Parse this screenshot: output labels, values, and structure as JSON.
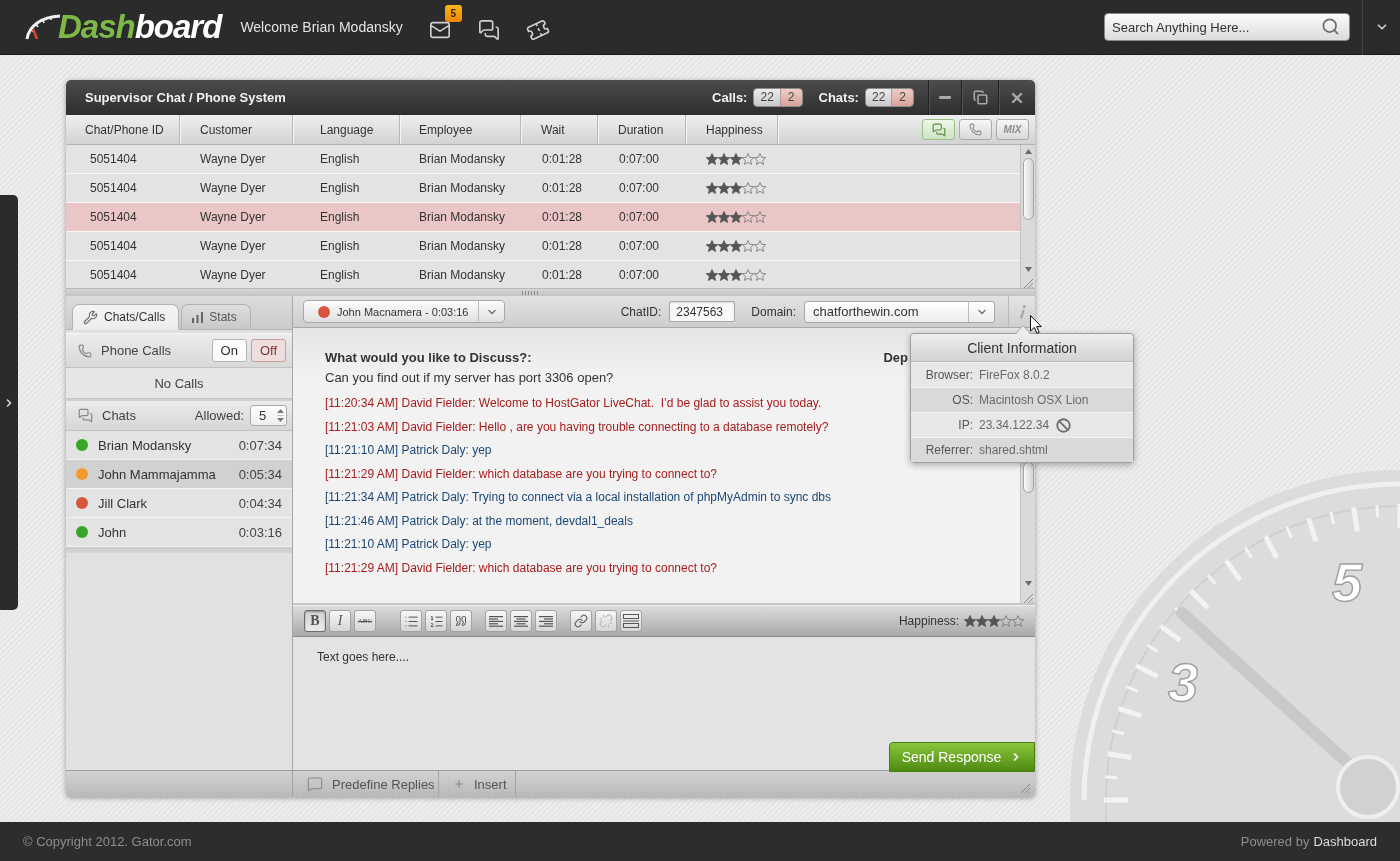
{
  "topbar": {
    "logo": {
      "accent": "Dash",
      "rest": "board"
    },
    "welcome": "Welcome Brian Modansky",
    "icons": [
      {
        "kind": "mail",
        "badge": "5"
      },
      {
        "kind": "chat"
      },
      {
        "kind": "ticket"
      }
    ],
    "search": {
      "placeholder": "Search Anything Here..."
    }
  },
  "window": {
    "title": "Supervisor Chat / Phone System",
    "counters": [
      {
        "label": "Calls:",
        "total": "22",
        "pending": "2"
      },
      {
        "label": "Chats:",
        "total": "22",
        "pending": "2"
      }
    ]
  },
  "table": {
    "columns": [
      "Chat/Phone ID",
      "Customer",
      "Language",
      "Employee",
      "Wait",
      "Duration",
      "Happiness"
    ],
    "view_toggles": [
      {
        "kind": "chat",
        "selected": true
      },
      {
        "kind": "phone",
        "selected": false
      },
      {
        "kind": "mix",
        "label": "MIX",
        "selected": false
      }
    ],
    "rows": [
      {
        "cells": [
          "5051404",
          "Wayne Dyer",
          "English",
          "Brian Modansky",
          "0:01:28",
          "0:07:00"
        ],
        "stars": 3,
        "selected": false
      },
      {
        "cells": [
          "5051404",
          "Wayne Dyer",
          "English",
          "Brian Modansky",
          "0:01:28",
          "0:07:00"
        ],
        "stars": 3,
        "selected": false
      },
      {
        "cells": [
          "5051404",
          "Wayne Dyer",
          "English",
          "Brian Modansky",
          "0:01:28",
          "0:07:00"
        ],
        "stars": 3,
        "selected": true
      },
      {
        "cells": [
          "5051404",
          "Wayne Dyer",
          "English",
          "Brian Modansky",
          "0:01:28",
          "0:07:00"
        ],
        "stars": 3,
        "selected": false
      },
      {
        "cells": [
          "5051404",
          "Wayne Dyer",
          "English",
          "Brian Modansky",
          "0:01:28",
          "0:07:00"
        ],
        "stars": 3,
        "selected": false
      }
    ]
  },
  "sidebar": {
    "tabs": [
      {
        "kind": "tools",
        "label": "Chats/Calls",
        "selected": true
      },
      {
        "kind": "stats",
        "label": "Stats",
        "selected": false
      }
    ],
    "phone_calls": {
      "label": "Phone Calls",
      "on_label": "On",
      "off_label": "Off",
      "on": false
    },
    "no_calls": "No Calls",
    "chats": {
      "label": "Chats",
      "allowed_label": "Allowed:",
      "allowed": "5"
    },
    "chat_list": [
      {
        "name": "Brian Modansky",
        "time": "0:07:34",
        "color": "#3aa52a",
        "selected": false
      },
      {
        "name": "John Mammajamma",
        "time": "0:05:34",
        "color": "#f39a2b",
        "selected": true
      },
      {
        "name": "Jill Clark",
        "time": "0:04:34",
        "color": "#d9543c",
        "selected": false
      },
      {
        "name": "John",
        "time": "0:03:16",
        "color": "#3aa52a",
        "selected": false
      }
    ]
  },
  "conversation": {
    "session": {
      "label": "John Macnamera - 0:03:16",
      "color": "#d9543c"
    },
    "chat_id_label": "ChatID:",
    "chat_id": "2347563",
    "domain_label": "Domain:",
    "domain": "chatforthewin.com",
    "question_label": "What would you like to Discuss?:",
    "question": "Can you find out if my server has port 3306 open?",
    "side_label": "Dep",
    "messages": [
      {
        "kind": "agent",
        "text": "[11:20:34 AM] David Fielder: Welcome to HostGator LiveChat.  I’d be glad to assist you today."
      },
      {
        "kind": "agent",
        "text": "[11:21:03 AM] David Fielder: Hello , are you having trouble connecting to a database remotely?"
      },
      {
        "kind": "customer",
        "text": "[11:21:10 AM] Patrick Daly: yep"
      },
      {
        "kind": "agent",
        "text": "[11:21:29 AM] David Fielder: which database are you trying to connect to?"
      },
      {
        "kind": "customer",
        "text": "[11:21:34 AM] Patrick Daly: Trying to connect via a local installation of phpMyAdmin to sync dbs"
      },
      {
        "kind": "customer",
        "text": "[11:21:46 AM] Patrick Daly: at the moment, devdal1_deals"
      },
      {
        "kind": "customer",
        "text": "[11:21:10 AM] Patrick Daly: yep"
      },
      {
        "kind": "agent",
        "text": "[11:21:29 AM] David Fielder: which database are you trying to connect to?"
      }
    ]
  },
  "client_info": {
    "title": "Client Information",
    "rows": [
      {
        "label": "Browser:",
        "value": "FireFox 8.0.2",
        "blockable": false
      },
      {
        "label": "OS:",
        "value": "Macintosh OSX Lion",
        "blockable": false
      },
      {
        "label": "IP:",
        "value": "23.34.122.34",
        "blockable": true
      },
      {
        "label": "Referrer:",
        "value": "shared.shtml",
        "blockable": false
      }
    ]
  },
  "editor": {
    "toolbar": [
      [
        {
          "kind": "bold",
          "label": "B",
          "active": true,
          "disabled": false
        },
        {
          "kind": "italic",
          "label": "I",
          "active": false,
          "disabled": false
        },
        {
          "kind": "strike",
          "label": "ABC",
          "active": false,
          "disabled": false
        }
      ],
      [
        {
          "kind": "bullets",
          "active": false,
          "disabled": false
        },
        {
          "kind": "numbers",
          "active": false,
          "disabled": false
        },
        {
          "kind": "quote",
          "active": false,
          "disabled": false
        }
      ],
      [
        {
          "kind": "align_left",
          "active": false,
          "disabled": false
        },
        {
          "kind": "align_center",
          "active": false,
          "disabled": false
        },
        {
          "kind": "align_right",
          "active": false,
          "disabled": false
        }
      ],
      [
        {
          "kind": "link",
          "active": false,
          "disabled": false
        },
        {
          "kind": "unlink",
          "active": false,
          "disabled": true
        },
        {
          "kind": "rule",
          "active": false,
          "disabled": false
        }
      ]
    ],
    "happiness_label": "Happiness:",
    "stars": 3,
    "placeholder": "Text goes here....",
    "send_label": "Send Response"
  },
  "bottom_bar": {
    "tabs": [
      {
        "kind": "replies",
        "label": "Predefine Replies"
      },
      {
        "kind": "insert",
        "label": "Insert"
      }
    ]
  },
  "footer": {
    "copyright": "© Copyright 2012. Gator.com",
    "powered_label": "Powered by",
    "powered_brand": "Dashboard"
  },
  "gauge": {
    "labels": [
      "5",
      "3"
    ]
  }
}
